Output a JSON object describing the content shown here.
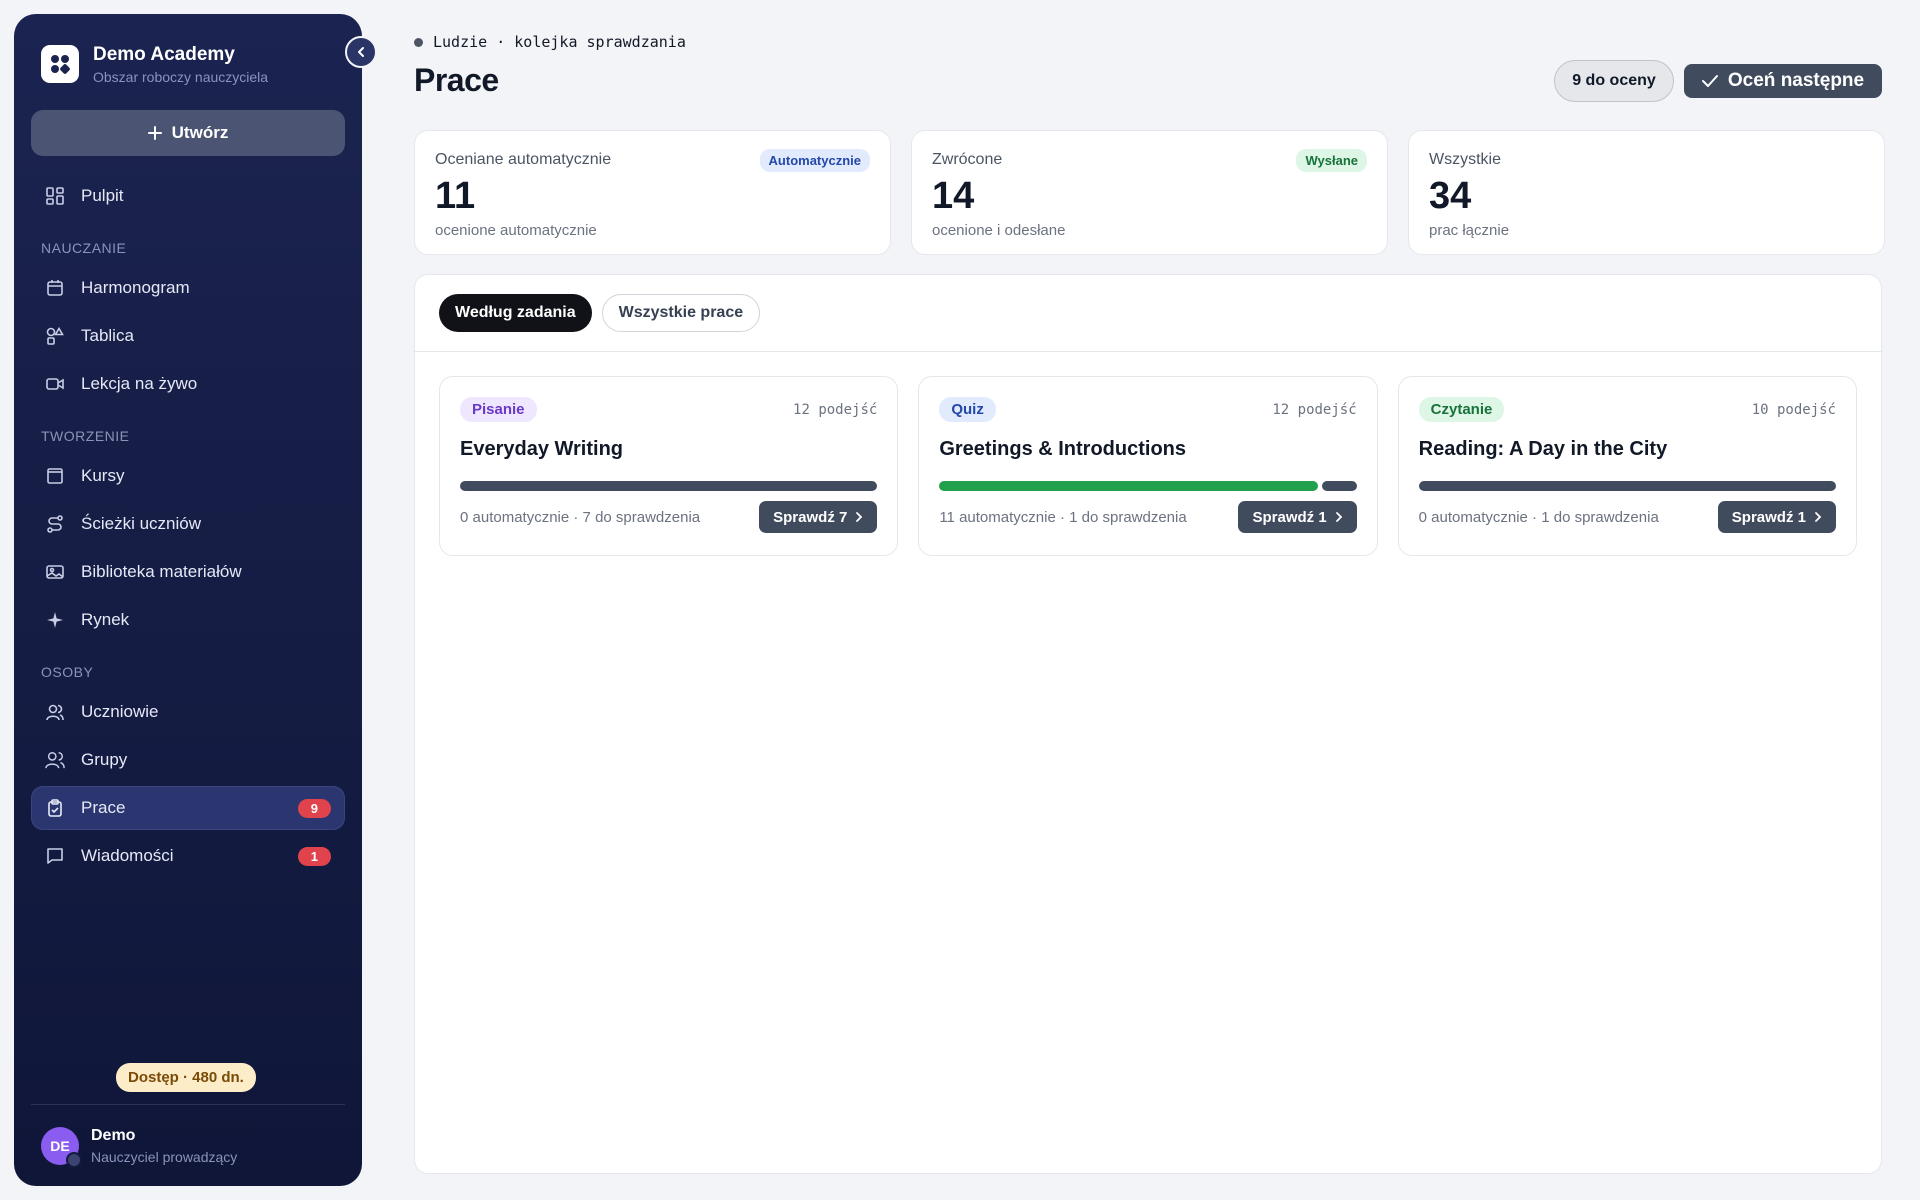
{
  "sidebar": {
    "brand_title": "Demo Academy",
    "brand_subtitle": "Obszar roboczy nauczyciela",
    "create_label": "Utwórz",
    "dashboard": {
      "label": "Pulpit",
      "icon": "dashboard-icon"
    },
    "sections": [
      {
        "title": "NAUCZANIE",
        "items": [
          {
            "label": "Harmonogram",
            "icon": "calendar-icon"
          },
          {
            "label": "Tablica",
            "icon": "shapes-icon"
          },
          {
            "label": "Lekcja na żywo",
            "icon": "video-icon"
          }
        ]
      },
      {
        "title": "TWORZENIE",
        "items": [
          {
            "label": "Kursy",
            "icon": "book-icon"
          },
          {
            "label": "Ścieżki uczniów",
            "icon": "route-icon"
          },
          {
            "label": "Biblioteka materiałów",
            "icon": "image-library-icon"
          },
          {
            "label": "Rynek",
            "icon": "sparkle-icon"
          }
        ]
      },
      {
        "title": "OSOBY",
        "items": [
          {
            "label": "Uczniowie",
            "icon": "user-icon"
          },
          {
            "label": "Grupy",
            "icon": "users-icon"
          },
          {
            "label": "Prace",
            "icon": "clipboard-check-icon",
            "badge": "9",
            "active": true
          },
          {
            "label": "Wiadomości",
            "icon": "message-icon",
            "badge": "1"
          }
        ]
      }
    ],
    "access_badge": "Dostęp · 480 dn.",
    "user": {
      "initials": "DE",
      "name": "Demo",
      "role": "Nauczyciel prowadzący"
    }
  },
  "header": {
    "breadcrumb": "Ludzie · kolejka sprawdzania",
    "title": "Prace",
    "pending_pill": "9 do oceny",
    "grade_next_label": "Oceń następne"
  },
  "stats": [
    {
      "label": "Oceniane automatycznie",
      "value": "11",
      "sub": "ocenione automatycznie",
      "tag": "Automatycznie",
      "tag_color": "#2348a8"
    },
    {
      "label": "Zwrócone",
      "value": "14",
      "sub": "ocenione i odesłane",
      "tag": "Wysłane",
      "tag_color": "#17733a"
    },
    {
      "label": "Wszystkie",
      "value": "34",
      "sub": "prac łącznie",
      "tag": ""
    }
  ],
  "tabs": [
    {
      "label": "Według zadania",
      "active": true
    },
    {
      "label": "Wszystkie prace",
      "active": false
    }
  ],
  "cards": [
    {
      "category": "Pisanie",
      "attempts": "12 podejść",
      "title": "Everyday Writing",
      "auto": 0,
      "review": 7,
      "meta": "0 automatycznie · 7 do sprawdzenia",
      "button": "Sprawdź 7"
    },
    {
      "category": "Quiz",
      "attempts": "12 podejść",
      "title": "Greetings & Introductions",
      "auto": 11,
      "review": 1,
      "meta": "11 automatycznie · 1 do sprawdzenia",
      "button": "Sprawdź 1"
    },
    {
      "category": "Czytanie",
      "attempts": "10 podejść",
      "title": "Reading: A Day in the City",
      "auto": 0,
      "review": 1,
      "meta": "0 automatycznie · 1 do sprawdzenia",
      "button": "Sprawdź 1"
    }
  ]
}
